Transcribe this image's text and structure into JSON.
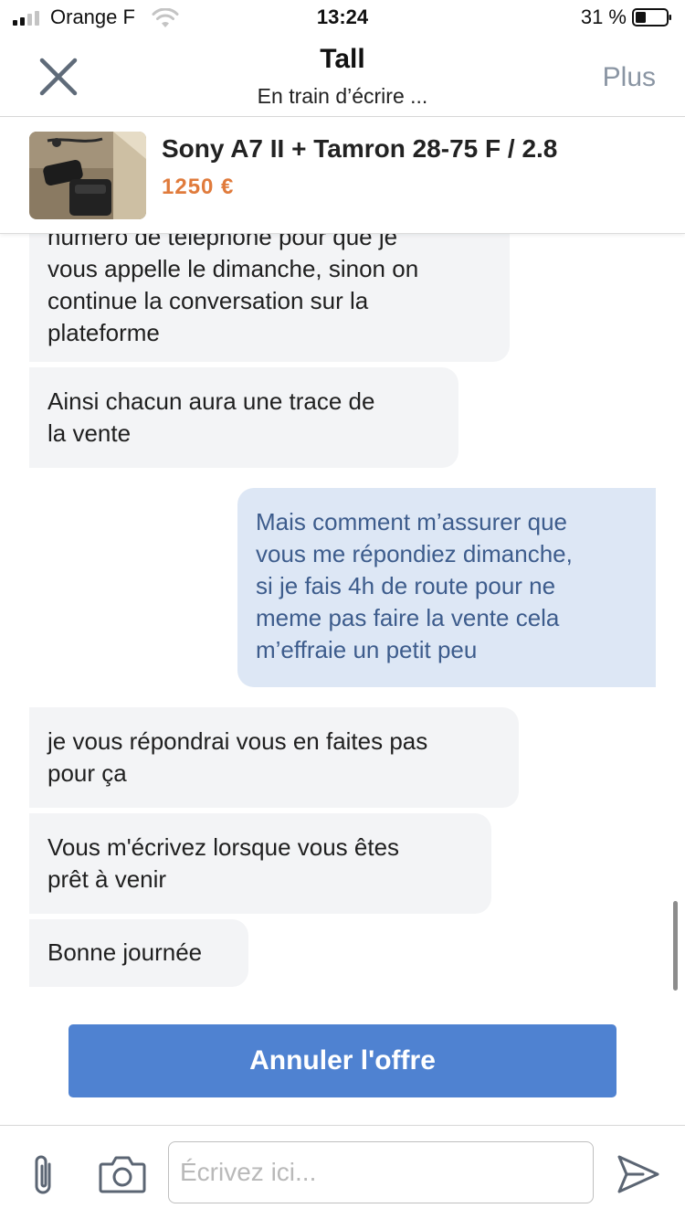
{
  "status_bar": {
    "carrier": "Orange F",
    "time": "13:24",
    "battery": "31 %"
  },
  "nav": {
    "title": "Tall",
    "subtitle": "En train d’écrire ...",
    "more_label": "Plus",
    "close_icon": "close-icon"
  },
  "product": {
    "title": "Sony A7 II + Tamron 28-75 F / 2.8",
    "price": "1250 €"
  },
  "messages": [
    {
      "direction": "in",
      "text": "numéro de téléphone pour que je\nvous appelle le dimanche, sinon on\ncontinue la conversation sur la\nplateforme"
    },
    {
      "direction": "in",
      "text": "Ainsi chacun aura une trace de\nla vente"
    },
    {
      "direction": "out",
      "text": "Mais comment m’assurer que\nvous me répondiez dimanche,\nsi je fais 4h de route pour ne\nmeme pas faire la vente cela\nm’effraie un petit peu"
    },
    {
      "direction": "in",
      "text": "je vous répondrai vous en faites pas\npour ça"
    },
    {
      "direction": "in",
      "text": "Vous m'écrivez lorsque vous êtes\nprêt à venir"
    },
    {
      "direction": "in",
      "text": "Bonne journée"
    }
  ],
  "actions": {
    "cancel_offer_label": "Annuler l'offre"
  },
  "compose": {
    "placeholder": "Écrivez ici...",
    "value": ""
  },
  "colors": {
    "accent": "#4f82d1",
    "price": "#e07b3c",
    "incoming_bubble": "#f3f4f6",
    "outgoing_bubble": "#dde7f5",
    "outgoing_text": "#3d5c8c"
  }
}
